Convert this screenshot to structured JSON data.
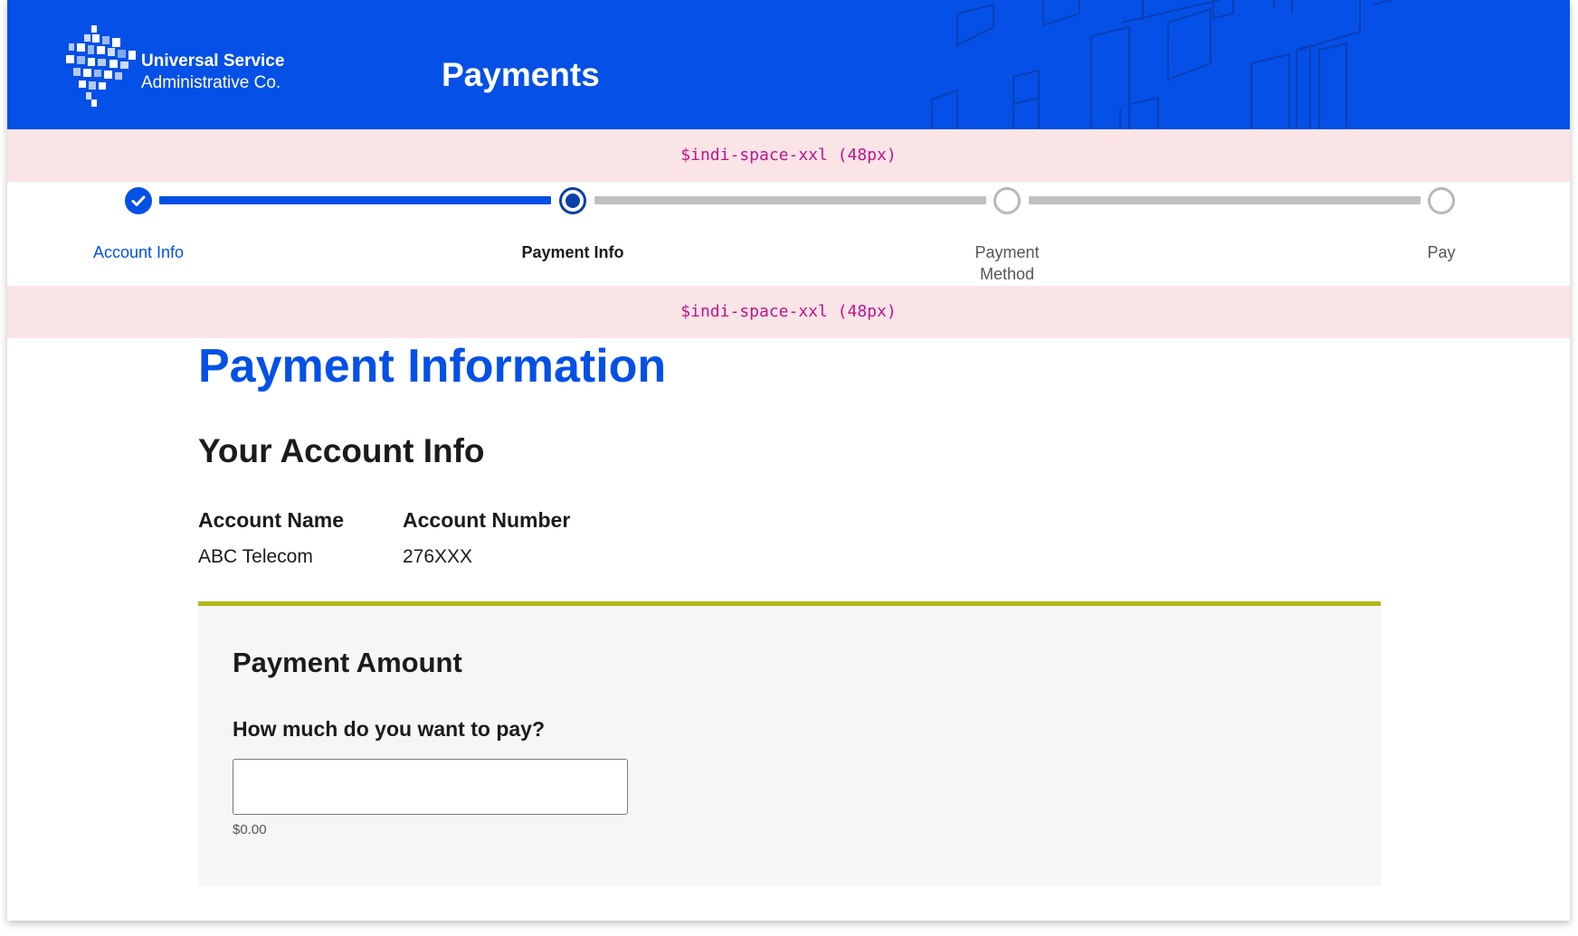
{
  "header": {
    "org_line1": "Universal Service",
    "org_line2": "Administrative Co.",
    "title": "Payments",
    "brand_color": "#0550e6"
  },
  "spacers": {
    "top_label": "$indi-space-xxl (48px)",
    "bottom_label": "$indi-space-xxl (48px)"
  },
  "stepper": {
    "steps": [
      {
        "label": "Account Info",
        "state": "complete"
      },
      {
        "label": "Payment Info",
        "state": "current"
      },
      {
        "label": "Payment\nMethod",
        "state": "pending"
      },
      {
        "label": "Pay",
        "state": "pending"
      }
    ]
  },
  "main": {
    "title": "Payment Information",
    "account_section": {
      "title": "Your Account Info",
      "name_label": "Account Name",
      "name_value": "ABC Telecom",
      "number_label": "Account Number",
      "number_value": "276XXX"
    },
    "payment_card": {
      "title": "Payment Amount",
      "question": "How much do you want to pay?",
      "input_value": "",
      "hint": "$0.00",
      "accent_color": "#b2b81a"
    }
  }
}
